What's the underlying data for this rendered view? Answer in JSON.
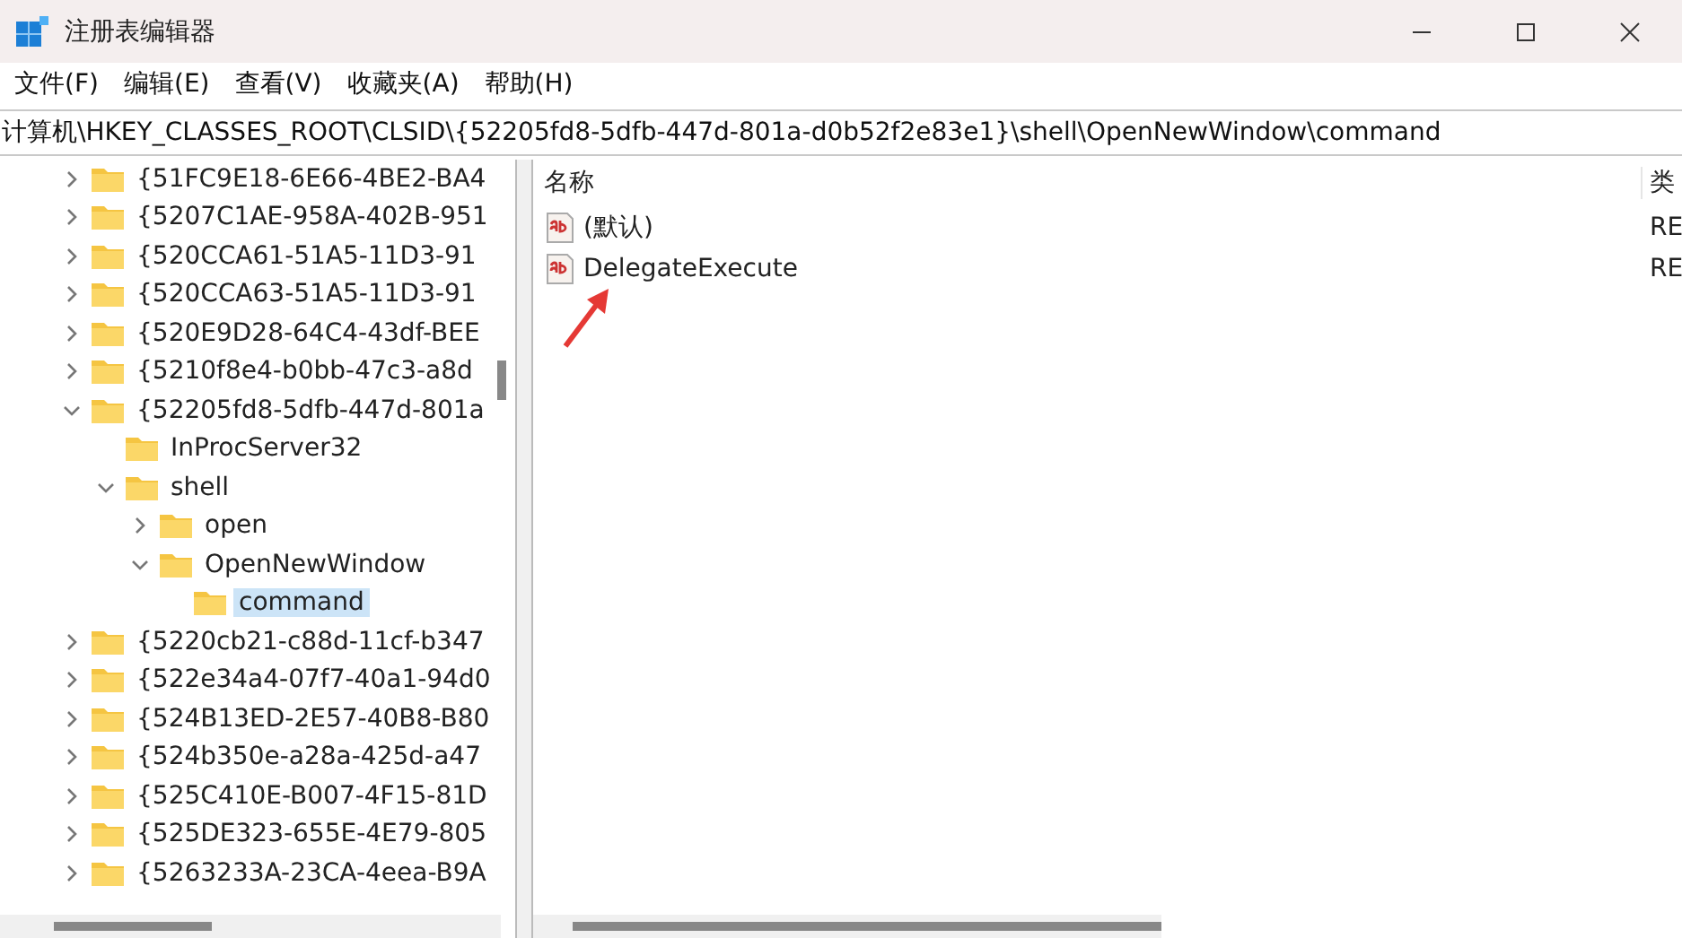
{
  "window": {
    "title": "注册表编辑器"
  },
  "menu": [
    {
      "label": "文件(F)"
    },
    {
      "label": "编辑(E)"
    },
    {
      "label": "查看(V)"
    },
    {
      "label": "收藏夹(A)"
    },
    {
      "label": "帮助(H)"
    }
  ],
  "address": {
    "value": "计算机\\HKEY_CLASSES_ROOT\\CLSID\\{52205fd8-5dfb-447d-801a-d0b52f2e83e1}\\shell\\OpenNewWindow\\command"
  },
  "tree": [
    {
      "label": "{51FC9E18-6E66-4BE2-BA4",
      "kind": "branch",
      "expanded": false,
      "selected": false
    },
    {
      "label": "{5207C1AE-958A-402B-951",
      "kind": "branch",
      "expanded": false,
      "selected": false
    },
    {
      "label": "{520CCA61-51A5-11D3-91",
      "kind": "branch",
      "expanded": false,
      "selected": false
    },
    {
      "label": "{520CCA63-51A5-11D3-91",
      "kind": "branch",
      "expanded": false,
      "selected": false
    },
    {
      "label": "{520E9D28-64C4-43df-BEE",
      "kind": "branch",
      "expanded": false,
      "selected": false
    },
    {
      "label": "{5210f8e4-b0bb-47c3-a8d",
      "kind": "branch",
      "expanded": false,
      "selected": false
    },
    {
      "label": "{52205fd8-5dfb-447d-801a",
      "kind": "branch",
      "expanded": true,
      "selected": false,
      "children": [
        {
          "label": "InProcServer32",
          "kind": "leaf",
          "selected": false
        },
        {
          "label": "shell",
          "kind": "branch",
          "expanded": true,
          "selected": false,
          "children": [
            {
              "label": "open",
              "kind": "branch",
              "expanded": false,
              "selected": false
            },
            {
              "label": "OpenNewWindow",
              "kind": "branch",
              "expanded": true,
              "selected": false,
              "children": [
                {
                  "label": "command",
                  "kind": "leaf",
                  "selected": true
                }
              ]
            }
          ]
        }
      ]
    },
    {
      "label": "{5220cb21-c88d-11cf-b347",
      "kind": "branch",
      "expanded": false,
      "selected": false
    },
    {
      "label": "{522e34a4-07f7-40a1-94d0",
      "kind": "branch",
      "expanded": false,
      "selected": false
    },
    {
      "label": "{524B13ED-2E57-40B8-B80",
      "kind": "branch",
      "expanded": false,
      "selected": false
    },
    {
      "label": "{524b350e-a28a-425d-a47",
      "kind": "branch",
      "expanded": false,
      "selected": false
    },
    {
      "label": "{525C410E-B007-4F15-81D",
      "kind": "branch",
      "expanded": false,
      "selected": false
    },
    {
      "label": "{525DE323-655E-4E79-805",
      "kind": "branch",
      "expanded": false,
      "selected": false
    },
    {
      "label": "{5263233A-23CA-4eea-B9A",
      "kind": "branch",
      "expanded": false,
      "selected": false
    }
  ],
  "values": {
    "columns": [
      {
        "label": "名称"
      },
      {
        "label": "类"
      }
    ],
    "rows": [
      {
        "name": "(默认)",
        "type": "RE",
        "selected": false
      },
      {
        "name": "DelegateExecute",
        "type": "RE",
        "selected": false
      }
    ]
  }
}
